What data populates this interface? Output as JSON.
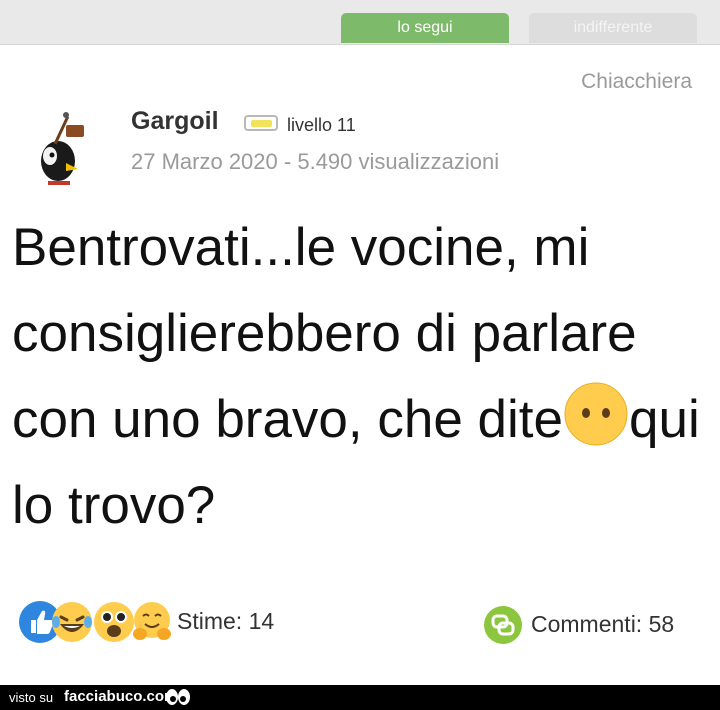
{
  "tabs": {
    "follow": "lo segui",
    "indifferent": "indifferente"
  },
  "post": {
    "category": "Chiacchiera",
    "author": "Gargoil",
    "level": "livello 11",
    "date": "27 Marzo 2020",
    "views": "5.490 visualizzazioni",
    "text_before_emoji": "Bentrovati...le vocine, mi consiglierebbero di parlare con uno bravo, che dite",
    "text_after_emoji": "qui lo trovo?"
  },
  "stats": {
    "likes": "Stime: 14",
    "comments": "Commenti: 58"
  },
  "footer": {
    "seen_on": "visto su",
    "site": "facciabuco.com"
  },
  "colors": {
    "follow_tab": "#7dbb6b",
    "like_blue": "#2e86de",
    "comment_green": "#8cc63f",
    "emoji_yellow": "#ffcc4d"
  },
  "icons": [
    "avatar-bird",
    "neutral-face-emoji",
    "thumbs-up-icon",
    "laugh-cry-emoji",
    "wow-emoji",
    "hug-emoji",
    "comment-icon",
    "eyes-icon"
  ]
}
